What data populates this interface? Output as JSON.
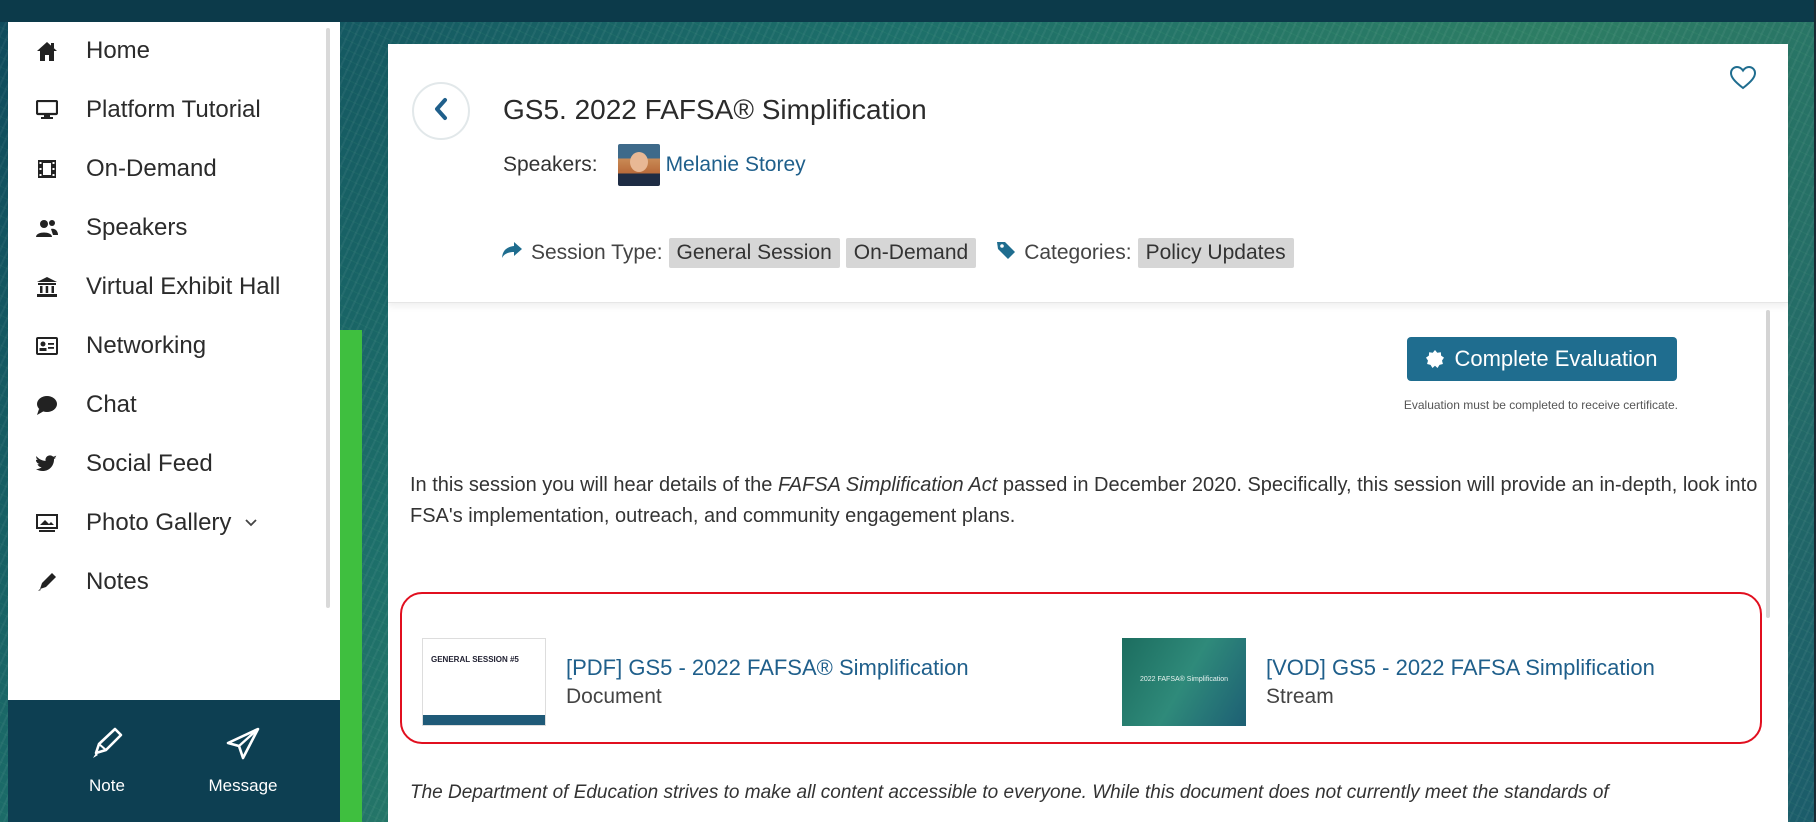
{
  "sidebar": {
    "items": [
      {
        "label": "Home",
        "icon": "home-icon"
      },
      {
        "label": "Platform Tutorial",
        "icon": "monitor-icon"
      },
      {
        "label": "On-Demand",
        "icon": "film-icon"
      },
      {
        "label": "Speakers",
        "icon": "users-icon"
      },
      {
        "label": "Virtual Exhibit Hall",
        "icon": "bank-icon"
      },
      {
        "label": "Networking",
        "icon": "id-card-icon"
      },
      {
        "label": "Chat",
        "icon": "chat-bubble-icon"
      },
      {
        "label": "Social Feed",
        "icon": "twitter-icon"
      },
      {
        "label": "Photo Gallery",
        "icon": "photo-icon",
        "has_dropdown": true
      },
      {
        "label": "Notes",
        "icon": "pencil-icon"
      }
    ],
    "bottom": {
      "note_label": "Note",
      "message_label": "Message"
    }
  },
  "session": {
    "title": "GS5. 2022 FAFSA® Simplification",
    "speakers_label": "Speakers:",
    "speaker_name": "Melanie Storey",
    "session_type_label": "Session Type:",
    "session_types": [
      "General Session",
      "On-Demand"
    ],
    "categories_label": "Categories:",
    "categories": [
      "Policy Updates"
    ],
    "evaluation_button": "Complete Evaluation",
    "evaluation_note": "Evaluation must be completed to receive certificate.",
    "description": {
      "before": "In this session you will hear details of the ",
      "act": "FAFSA Simplification Act",
      "after": " passed in December 2020. Specifically, this session will provide an in-depth, look into FSA's implementation, outreach, and community engagement plans."
    },
    "resources": [
      {
        "title": "[PDF] GS5 - 2022 FAFSA® Simplification",
        "type": "Document",
        "thumb_text": "GENERAL SESSION #5"
      },
      {
        "title": "[VOD] GS5 - 2022 FAFSA Simplification",
        "type": "Stream",
        "thumb_text": "2022 FAFSA® Simplification"
      }
    ],
    "disclaimer": "The Department of Education strives to make all content accessible to everyone. While this document does not currently meet the standards of"
  },
  "colors": {
    "accent": "#1f6d8f",
    "sidebar_bottom": "#0d3f52",
    "highlight_border": "#e10f1f",
    "link": "#1f5f8b",
    "green_bar": "#3fbf3f"
  }
}
